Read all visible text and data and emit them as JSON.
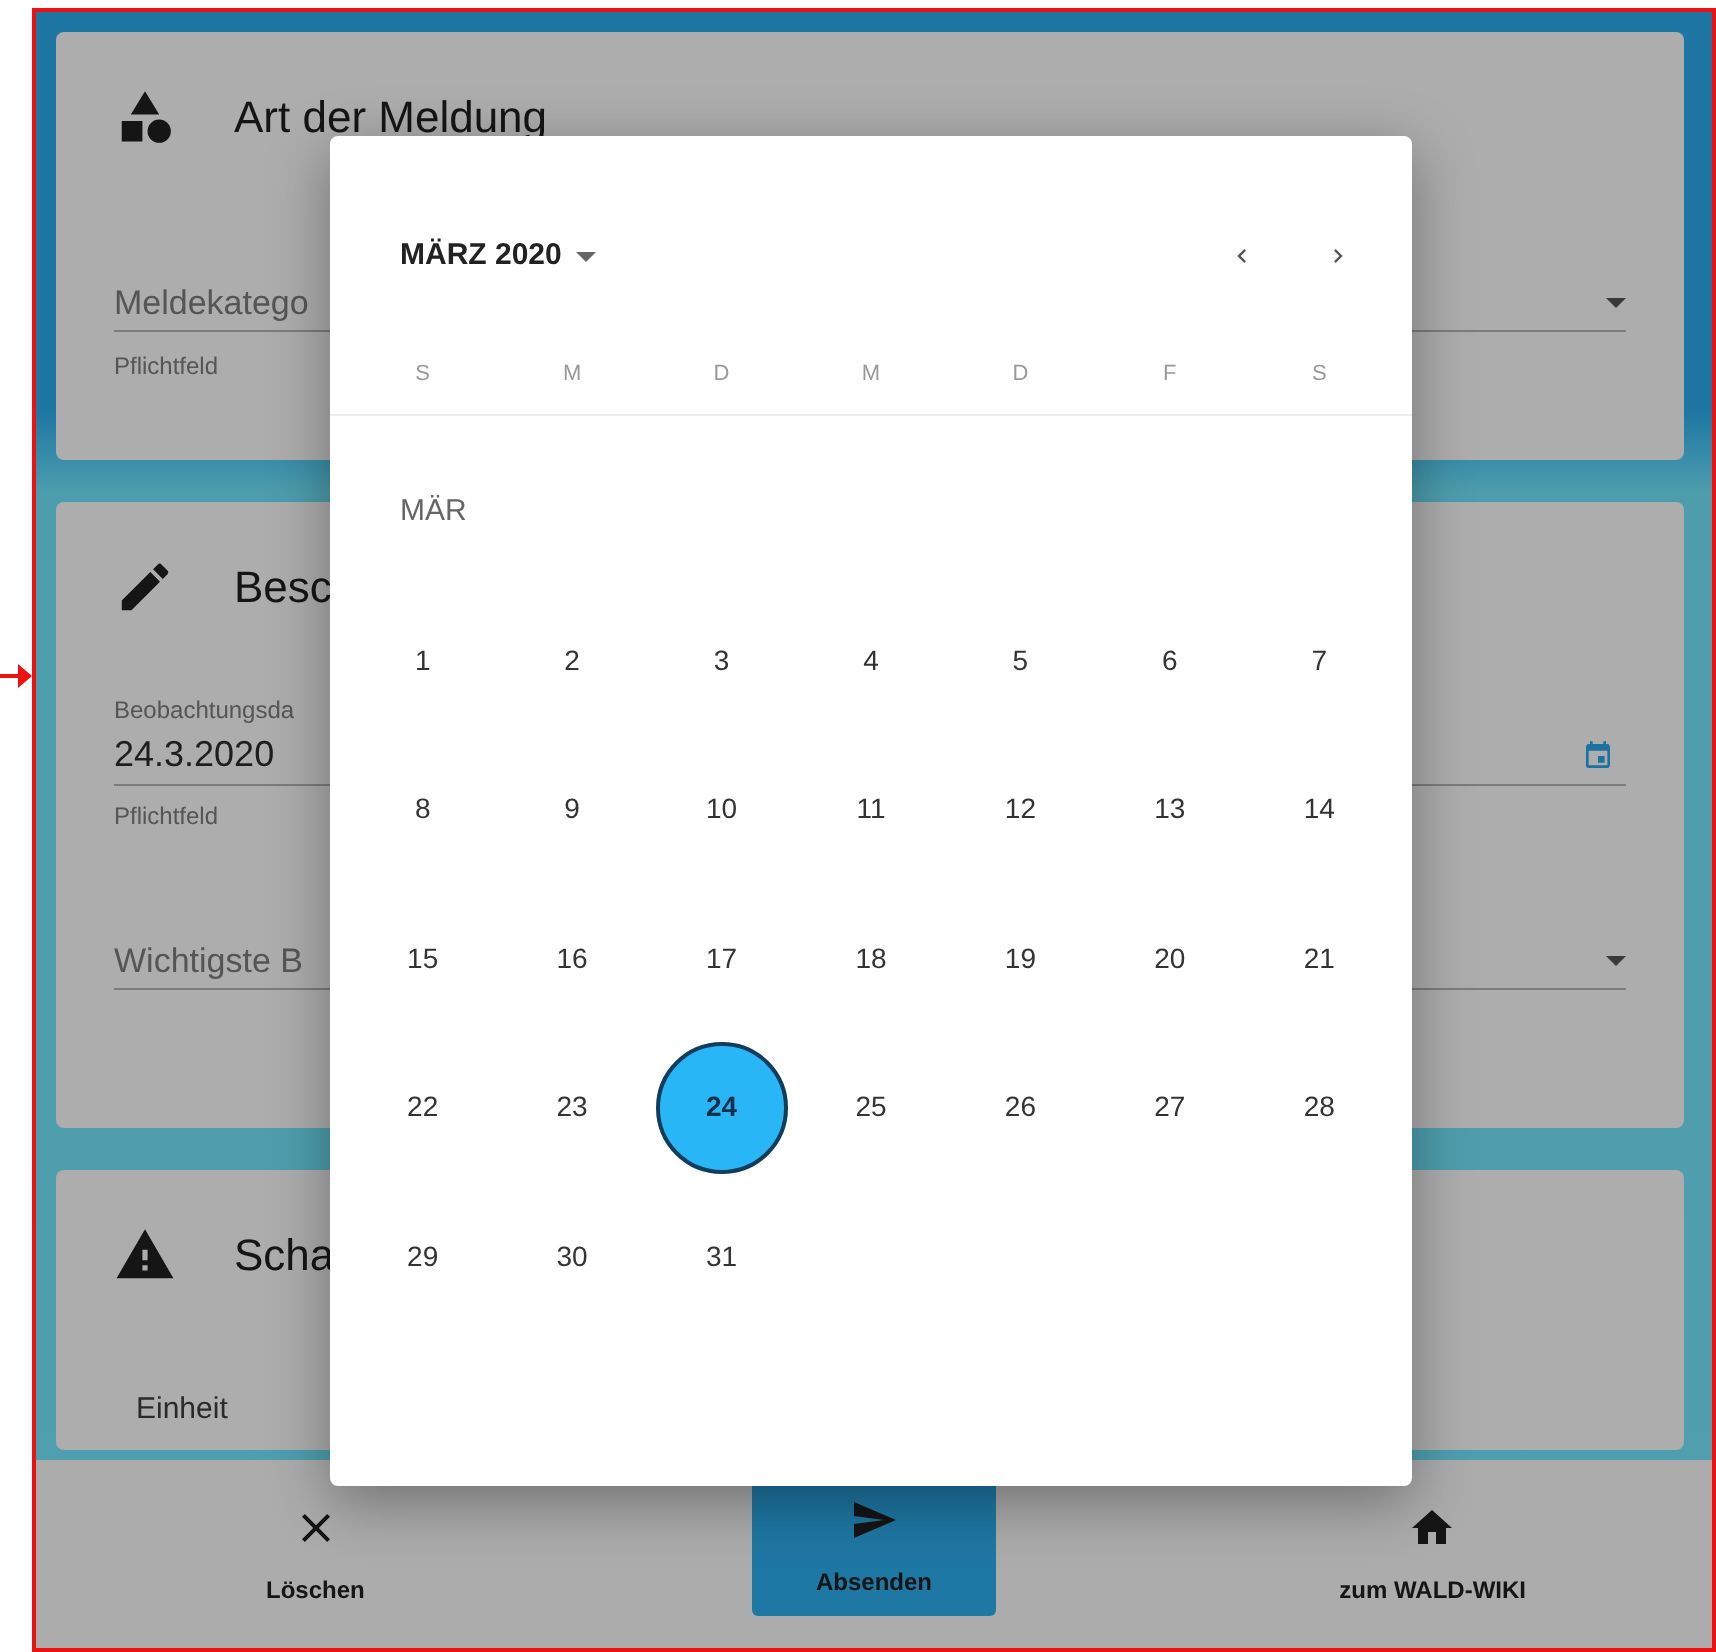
{
  "form": {
    "sections": [
      {
        "title": "Art der Meldung",
        "fields": [
          {
            "kind": "select",
            "label": "Meldekatego",
            "helper": "Pflichtfeld"
          }
        ]
      },
      {
        "title": "Besc",
        "fields": [
          {
            "kind": "date",
            "label": "Beobachtungsda",
            "value": "24.3.2020",
            "helper": "Pflichtfeld"
          },
          {
            "kind": "select",
            "label": "Wichtigste B"
          }
        ]
      },
      {
        "title": "Scha",
        "fields": [
          {
            "kind": "text",
            "label": "Einheit"
          }
        ]
      }
    ]
  },
  "date_picker": {
    "month_label": "MÄRZ 2020",
    "weekdays": [
      "S",
      "M",
      "D",
      "M",
      "D",
      "F",
      "S"
    ],
    "month_short": "MÄR",
    "days": [
      {
        "label": "1",
        "selected": false
      },
      {
        "label": "2",
        "selected": false
      },
      {
        "label": "3",
        "selected": false
      },
      {
        "label": "4",
        "selected": false
      },
      {
        "label": "5",
        "selected": false
      },
      {
        "label": "6",
        "selected": false
      },
      {
        "label": "7",
        "selected": false
      },
      {
        "label": "8",
        "selected": false
      },
      {
        "label": "9",
        "selected": false
      },
      {
        "label": "10",
        "selected": false
      },
      {
        "label": "11",
        "selected": false
      },
      {
        "label": "12",
        "selected": false
      },
      {
        "label": "13",
        "selected": false
      },
      {
        "label": "14",
        "selected": false
      },
      {
        "label": "15",
        "selected": false
      },
      {
        "label": "16",
        "selected": false
      },
      {
        "label": "17",
        "selected": false
      },
      {
        "label": "18",
        "selected": false
      },
      {
        "label": "19",
        "selected": false
      },
      {
        "label": "20",
        "selected": false
      },
      {
        "label": "21",
        "selected": false
      },
      {
        "label": "22",
        "selected": false
      },
      {
        "label": "23",
        "selected": false
      },
      {
        "label": "24",
        "selected": true
      },
      {
        "label": "25",
        "selected": false
      },
      {
        "label": "26",
        "selected": false
      },
      {
        "label": "27",
        "selected": false
      },
      {
        "label": "28",
        "selected": false
      },
      {
        "label": "29",
        "selected": false
      },
      {
        "label": "30",
        "selected": false
      },
      {
        "label": "31",
        "selected": false
      }
    ]
  },
  "bottom_bar": {
    "actions": [
      {
        "label": "Löschen",
        "primary": false
      },
      {
        "label": "Absenden",
        "primary": true
      },
      {
        "label": "zum WALD-WIKI",
        "primary": false
      }
    ]
  }
}
